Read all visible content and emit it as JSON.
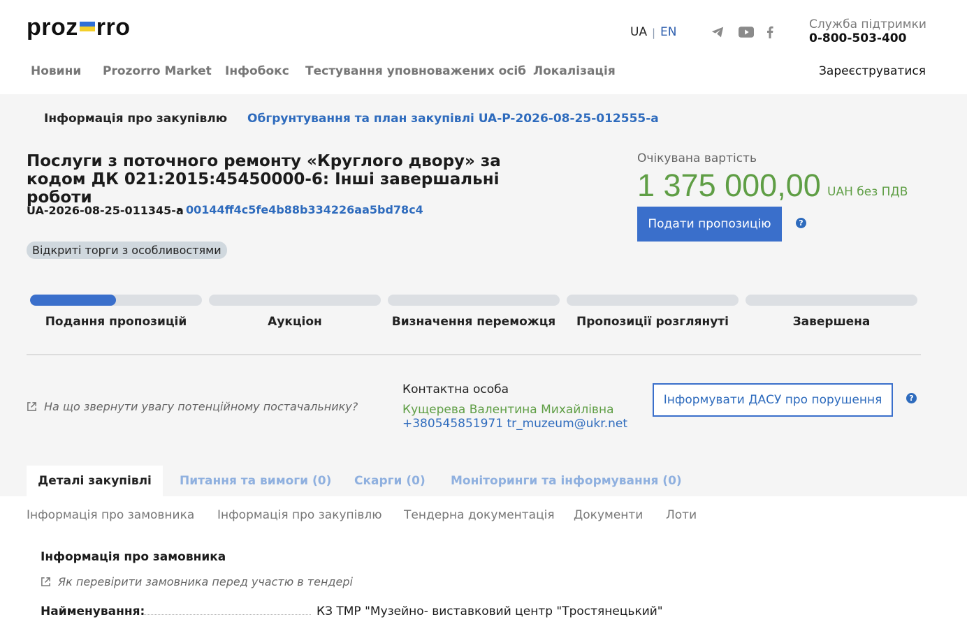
{
  "header": {
    "logo_left": "proz",
    "logo_right": "rro",
    "flag_colors": [
      "#2f6fd6",
      "#f3cf2b"
    ],
    "lang": {
      "ua": "UA",
      "sep": "|",
      "en": "EN"
    },
    "social_icons": [
      "telegram-icon",
      "youtube-icon",
      "facebook-icon"
    ],
    "support": {
      "title": "Служба підтримки",
      "phone": "0-800-503-400"
    },
    "nav": [
      "Новини",
      "Prozorro Market",
      "Інфобокс",
      "Тестування уповноважених осіб",
      "Локалізація"
    ],
    "register": "Зареєструватися"
  },
  "breadcrumbs": {
    "info": "Інформація про закупівлю",
    "plan": "Обгрунтування та план закупівлі UA-P-2026-08-25-012555-a"
  },
  "tender": {
    "title": "Послуги з поточного ремонту «Круглого двору» за кодом ДК 021:2015:45450000-6: Інші завершальні роботи",
    "id": "UA-2026-08-25-011345-a",
    "dot": "•",
    "hash": "00144ff4c5fe4b88b334226aa5bd78c4",
    "procedure": "Відкриті торги з особливостями",
    "expected_label": "Очікувана вартість",
    "amount": "1 375 000,00",
    "currency": "UAH без ПДВ",
    "submit": "Подати пропозицію",
    "help": "?"
  },
  "stages": {
    "items": [
      "Подання пропозицій",
      "Аукціон",
      "Визначення переможця",
      "Пропозиції розглянуті",
      "Завершена"
    ],
    "current_progress": 0.5
  },
  "contact": {
    "hint": "На що звернути увагу потенційному постачальнику?",
    "label": "Контактна особа",
    "name": "Кущерева Валентина Михайлівна",
    "phone_email": "+380545851971 tr_muzeum@ukr.net",
    "dasu": "Інформувати ДАСУ про порушення"
  },
  "tabs": [
    "Деталі закупівлі",
    "Питання та вимоги (0)",
    "Скарги (0)",
    "Моніторинги та інформування (0)"
  ],
  "subtabs": [
    "Інформація про замовника",
    "Інформація про закупівлю",
    "Тендерна документація",
    "Документи",
    "Лоти"
  ],
  "customer": {
    "section_title": "Інформація про замовника",
    "check_hint": "Як перевірити замовника перед участю в тендері",
    "name_label": "Найменування:",
    "name_value": "КЗ ТМР \"Музейно- виставковий центр \"Тростянецький\""
  },
  "colors": {
    "accent": "#3a6fcb",
    "link": "#2e6bbd",
    "money": "#5f9e45"
  }
}
